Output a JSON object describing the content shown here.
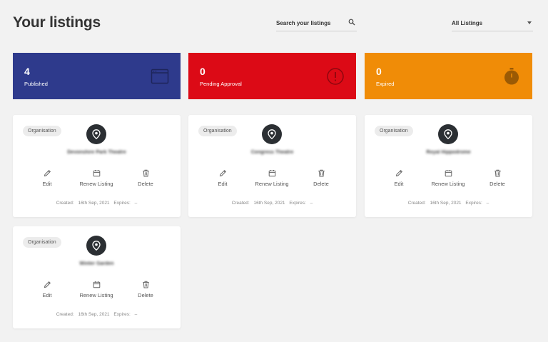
{
  "page": {
    "title": "Your listings"
  },
  "search": {
    "placeholder": "Search your listings"
  },
  "filter": {
    "selected": "All Listings"
  },
  "stats": [
    {
      "count": "4",
      "label": "Published",
      "color": "#2e3a8c",
      "icon": "browser-window-icon"
    },
    {
      "count": "0",
      "label": "Pending Approval",
      "color": "#dc0a16",
      "icon": "info-circle-icon"
    },
    {
      "count": "0",
      "label": "Expired",
      "color": "#f08c07",
      "icon": "stopwatch-icon"
    }
  ],
  "listings": [
    {
      "type": "Organisation",
      "name": "Devonshire Park Theatre",
      "created_label": "Created:",
      "created": "16th Sep, 2021",
      "expires_label": "Expires:",
      "expires": "–"
    },
    {
      "type": "Organisation",
      "name": "Congress Theatre",
      "created_label": "Created:",
      "created": "16th Sep, 2021",
      "expires_label": "Expires:",
      "expires": "–"
    },
    {
      "type": "Organisation",
      "name": "Royal Hippodrome",
      "created_label": "Created:",
      "created": "16th Sep, 2021",
      "expires_label": "Expires:",
      "expires": "–"
    },
    {
      "type": "Organisation",
      "name": "Winter Garden",
      "created_label": "Created:",
      "created": "16th Sep, 2021",
      "expires_label": "Expires:",
      "expires": "–"
    }
  ],
  "actions": {
    "edit": "Edit",
    "renew": "Renew Listing",
    "delete": "Delete"
  }
}
